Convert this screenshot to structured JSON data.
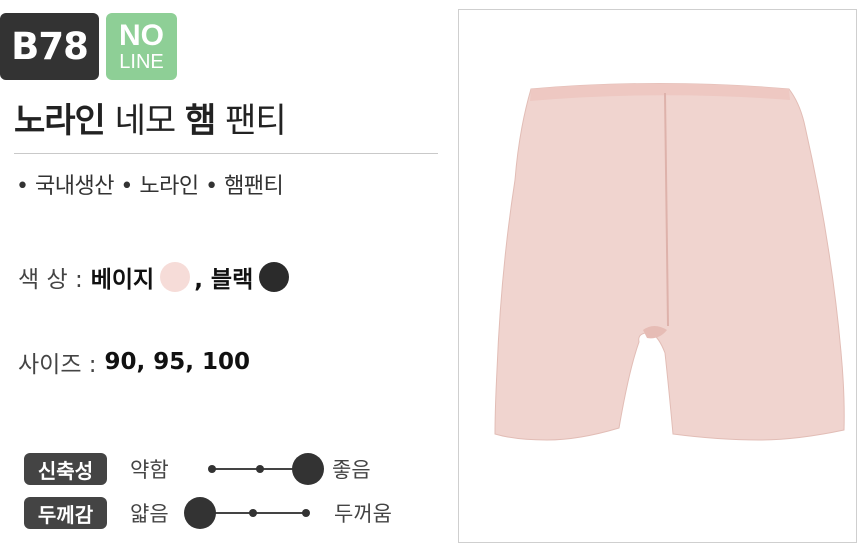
{
  "product": {
    "code": "B78",
    "badge_line1": "NO",
    "badge_line2": "LINE",
    "title_part1": "노라인",
    "title_part2": "네모",
    "title_part3": "햄",
    "title_part4": "팬티",
    "features": "• 국내생산 • 노라인 • 햄팬티"
  },
  "colors": {
    "label": "색   상 :",
    "options": [
      {
        "name": "베이지",
        "hex": "#f6dcd8"
      },
      {
        "name": ", 블랙",
        "hex": "#2b2b2b"
      }
    ]
  },
  "sizes": {
    "label": "사이즈 :",
    "value": "90, 95, 100"
  },
  "scales": {
    "stretch": {
      "tag": "신축성",
      "low": "약함",
      "high": "좋음",
      "level": 3,
      "steps": 3
    },
    "thickness": {
      "tag": "두께감",
      "low": "얇음",
      "high": "두꺼움",
      "level": 1,
      "steps": 3
    }
  },
  "palette": {
    "accent_green": "#8ecf96",
    "badge_dark": "#333333",
    "garment_pink": "#f0d4cf"
  }
}
